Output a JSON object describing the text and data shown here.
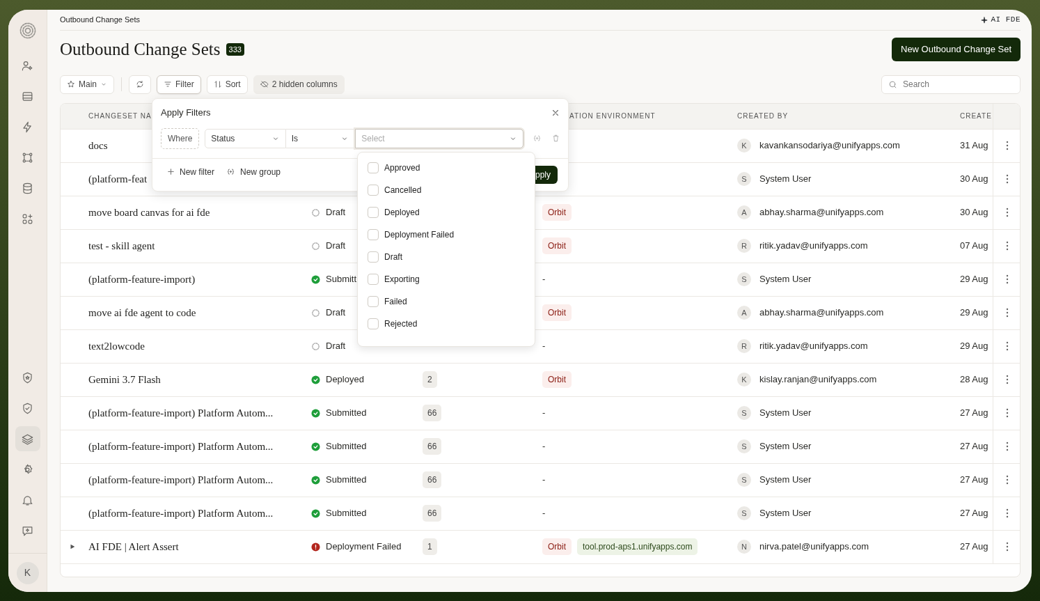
{
  "sidebar": {
    "items": [
      {
        "selected": false
      },
      {
        "selected": false
      },
      {
        "selected": false
      },
      {
        "selected": false
      },
      {
        "selected": false
      },
      {
        "selected": false
      }
    ],
    "bottom_items": [
      {
        "selected": false
      },
      {
        "selected": false
      },
      {
        "selected": true
      },
      {
        "selected": false
      },
      {
        "selected": false
      },
      {
        "selected": false
      }
    ],
    "avatar": "K"
  },
  "breadcrumb": "Outbound Change Sets",
  "assistant_link": "AI FDE",
  "title": "Outbound Change Sets",
  "count": "333",
  "primary_button": "New Outbound Change Set",
  "toolbar": {
    "view": "Main",
    "filter": "Filter",
    "sort": "Sort",
    "hidden_columns": "2 hidden columns"
  },
  "search": {
    "placeholder": "Search"
  },
  "table": {
    "columns": [
      "CHANGESET NA",
      "",
      "",
      "ATION ENVIRONMENT",
      "CREATED BY",
      "CREATE"
    ],
    "rows": [
      {
        "name": "docs",
        "created_by": {
          "initial": "K",
          "label": "kavankansodariya@unifyapps.com"
        },
        "created": "31 Aug"
      },
      {
        "name": "(platform-feat",
        "created_by": {
          "initial": "S",
          "label": "System User"
        },
        "created": "30 Aug"
      },
      {
        "name": "move board canvas for ai fde",
        "status": {
          "kind": "draft",
          "label": "Draft"
        },
        "environments": [
          {
            "kind": "orbit",
            "label": "Orbit"
          }
        ],
        "created_by": {
          "initial": "A",
          "label": "abhay.sharma@unifyapps.com"
        },
        "created": "30 Aug"
      },
      {
        "name": "test - skill agent",
        "status": {
          "kind": "draft",
          "label": "Draft"
        },
        "environments": [
          {
            "kind": "orbit",
            "label": "Orbit"
          }
        ],
        "created_by": {
          "initial": "R",
          "label": "ritik.yadav@unifyapps.com"
        },
        "created": "07 Aug"
      },
      {
        "name": "(platform-feature-import)",
        "status": {
          "kind": "success",
          "label": "Submitt"
        },
        "empty_env": "-",
        "created_by": {
          "initial": "S",
          "label": "System User"
        },
        "created": "29 Aug"
      },
      {
        "name": "move ai fde agent to code",
        "status": {
          "kind": "draft",
          "label": "Draft"
        },
        "environments": [
          {
            "kind": "orbit",
            "label": "Orbit"
          }
        ],
        "created_by": {
          "initial": "A",
          "label": "abhay.sharma@unifyapps.com"
        },
        "created": "29 Aug"
      },
      {
        "name": "text2lowcode",
        "status": {
          "kind": "draft",
          "label": "Draft"
        },
        "empty_env": "-",
        "created_by": {
          "initial": "R",
          "label": "ritik.yadav@unifyapps.com"
        },
        "created": "29 Aug"
      },
      {
        "name": "Gemini 3.7 Flash",
        "status": {
          "kind": "success",
          "label": "Deployed"
        },
        "count": "2",
        "environments": [
          {
            "kind": "orbit",
            "label": "Orbit"
          }
        ],
        "created_by": {
          "initial": "K",
          "label": "kislay.ranjan@unifyapps.com"
        },
        "created": "28 Aug"
      },
      {
        "name": "(platform-feature-import) Platform Autom...",
        "status": {
          "kind": "success",
          "label": "Submitted"
        },
        "count": "66",
        "empty_env": "-",
        "created_by": {
          "initial": "S",
          "label": "System User"
        },
        "created": "27 Aug"
      },
      {
        "name": "(platform-feature-import) Platform Autom...",
        "status": {
          "kind": "success",
          "label": "Submitted"
        },
        "count": "66",
        "empty_env": "-",
        "created_by": {
          "initial": "S",
          "label": "System User"
        },
        "created": "27 Aug"
      },
      {
        "name": "(platform-feature-import) Platform Autom...",
        "status": {
          "kind": "success",
          "label": "Submitted"
        },
        "count": "66",
        "empty_env": "-",
        "created_by": {
          "initial": "S",
          "label": "System User"
        },
        "created": "27 Aug"
      },
      {
        "name": "(platform-feature-import) Platform Autom...",
        "status": {
          "kind": "success",
          "label": "Submitted"
        },
        "count": "66",
        "empty_env": "-",
        "created_by": {
          "initial": "S",
          "label": "System User"
        },
        "created": "27 Aug"
      },
      {
        "name": "AI FDE | Alert Assert",
        "expandable": true,
        "status": {
          "kind": "error",
          "label": "Deployment Failed"
        },
        "count": "1",
        "environments": [
          {
            "kind": "orbit",
            "label": "Orbit"
          },
          {
            "kind": "host",
            "label": "tool.prod-aps1.unifyapps.com"
          }
        ],
        "created_by": {
          "initial": "N",
          "label": "nirva.patel@unifyapps.com"
        },
        "created": "27 Aug"
      }
    ]
  },
  "filter_panel": {
    "title": "Apply Filters",
    "where": "Where",
    "field": "Status",
    "operator": "Is",
    "value": {
      "placeholder": "Select"
    },
    "new_filter": "New filter",
    "new_group": "New group",
    "apply": "pply",
    "options": [
      {
        "label": "Approved",
        "checked": false
      },
      {
        "label": "Cancelled",
        "checked": false
      },
      {
        "label": "Deployed",
        "checked": false
      },
      {
        "label": "Deployment Failed",
        "checked": false
      },
      {
        "label": "Draft",
        "checked": false
      },
      {
        "label": "Exporting",
        "checked": false
      },
      {
        "label": "Failed",
        "checked": false
      },
      {
        "label": "Rejected",
        "checked": false
      }
    ]
  }
}
